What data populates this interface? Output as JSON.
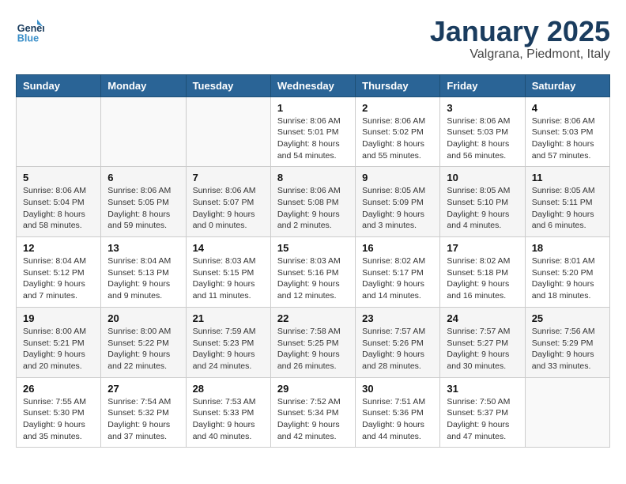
{
  "header": {
    "logo_line1": "General",
    "logo_line2": "Blue",
    "month_title": "January 2025",
    "location": "Valgrana, Piedmont, Italy"
  },
  "weekdays": [
    "Sunday",
    "Monday",
    "Tuesday",
    "Wednesday",
    "Thursday",
    "Friday",
    "Saturday"
  ],
  "weeks": [
    [
      {
        "day": "",
        "info": ""
      },
      {
        "day": "",
        "info": ""
      },
      {
        "day": "",
        "info": ""
      },
      {
        "day": "1",
        "info": "Sunrise: 8:06 AM\nSunset: 5:01 PM\nDaylight: 8 hours\nand 54 minutes."
      },
      {
        "day": "2",
        "info": "Sunrise: 8:06 AM\nSunset: 5:02 PM\nDaylight: 8 hours\nand 55 minutes."
      },
      {
        "day": "3",
        "info": "Sunrise: 8:06 AM\nSunset: 5:03 PM\nDaylight: 8 hours\nand 56 minutes."
      },
      {
        "day": "4",
        "info": "Sunrise: 8:06 AM\nSunset: 5:03 PM\nDaylight: 8 hours\nand 57 minutes."
      }
    ],
    [
      {
        "day": "5",
        "info": "Sunrise: 8:06 AM\nSunset: 5:04 PM\nDaylight: 8 hours\nand 58 minutes."
      },
      {
        "day": "6",
        "info": "Sunrise: 8:06 AM\nSunset: 5:05 PM\nDaylight: 8 hours\nand 59 minutes."
      },
      {
        "day": "7",
        "info": "Sunrise: 8:06 AM\nSunset: 5:07 PM\nDaylight: 9 hours\nand 0 minutes."
      },
      {
        "day": "8",
        "info": "Sunrise: 8:06 AM\nSunset: 5:08 PM\nDaylight: 9 hours\nand 2 minutes."
      },
      {
        "day": "9",
        "info": "Sunrise: 8:05 AM\nSunset: 5:09 PM\nDaylight: 9 hours\nand 3 minutes."
      },
      {
        "day": "10",
        "info": "Sunrise: 8:05 AM\nSunset: 5:10 PM\nDaylight: 9 hours\nand 4 minutes."
      },
      {
        "day": "11",
        "info": "Sunrise: 8:05 AM\nSunset: 5:11 PM\nDaylight: 9 hours\nand 6 minutes."
      }
    ],
    [
      {
        "day": "12",
        "info": "Sunrise: 8:04 AM\nSunset: 5:12 PM\nDaylight: 9 hours\nand 7 minutes."
      },
      {
        "day": "13",
        "info": "Sunrise: 8:04 AM\nSunset: 5:13 PM\nDaylight: 9 hours\nand 9 minutes."
      },
      {
        "day": "14",
        "info": "Sunrise: 8:03 AM\nSunset: 5:15 PM\nDaylight: 9 hours\nand 11 minutes."
      },
      {
        "day": "15",
        "info": "Sunrise: 8:03 AM\nSunset: 5:16 PM\nDaylight: 9 hours\nand 12 minutes."
      },
      {
        "day": "16",
        "info": "Sunrise: 8:02 AM\nSunset: 5:17 PM\nDaylight: 9 hours\nand 14 minutes."
      },
      {
        "day": "17",
        "info": "Sunrise: 8:02 AM\nSunset: 5:18 PM\nDaylight: 9 hours\nand 16 minutes."
      },
      {
        "day": "18",
        "info": "Sunrise: 8:01 AM\nSunset: 5:20 PM\nDaylight: 9 hours\nand 18 minutes."
      }
    ],
    [
      {
        "day": "19",
        "info": "Sunrise: 8:00 AM\nSunset: 5:21 PM\nDaylight: 9 hours\nand 20 minutes."
      },
      {
        "day": "20",
        "info": "Sunrise: 8:00 AM\nSunset: 5:22 PM\nDaylight: 9 hours\nand 22 minutes."
      },
      {
        "day": "21",
        "info": "Sunrise: 7:59 AM\nSunset: 5:23 PM\nDaylight: 9 hours\nand 24 minutes."
      },
      {
        "day": "22",
        "info": "Sunrise: 7:58 AM\nSunset: 5:25 PM\nDaylight: 9 hours\nand 26 minutes."
      },
      {
        "day": "23",
        "info": "Sunrise: 7:57 AM\nSunset: 5:26 PM\nDaylight: 9 hours\nand 28 minutes."
      },
      {
        "day": "24",
        "info": "Sunrise: 7:57 AM\nSunset: 5:27 PM\nDaylight: 9 hours\nand 30 minutes."
      },
      {
        "day": "25",
        "info": "Sunrise: 7:56 AM\nSunset: 5:29 PM\nDaylight: 9 hours\nand 33 minutes."
      }
    ],
    [
      {
        "day": "26",
        "info": "Sunrise: 7:55 AM\nSunset: 5:30 PM\nDaylight: 9 hours\nand 35 minutes."
      },
      {
        "day": "27",
        "info": "Sunrise: 7:54 AM\nSunset: 5:32 PM\nDaylight: 9 hours\nand 37 minutes."
      },
      {
        "day": "28",
        "info": "Sunrise: 7:53 AM\nSunset: 5:33 PM\nDaylight: 9 hours\nand 40 minutes."
      },
      {
        "day": "29",
        "info": "Sunrise: 7:52 AM\nSunset: 5:34 PM\nDaylight: 9 hours\nand 42 minutes."
      },
      {
        "day": "30",
        "info": "Sunrise: 7:51 AM\nSunset: 5:36 PM\nDaylight: 9 hours\nand 44 minutes."
      },
      {
        "day": "31",
        "info": "Sunrise: 7:50 AM\nSunset: 5:37 PM\nDaylight: 9 hours\nand 47 minutes."
      },
      {
        "day": "",
        "info": ""
      }
    ]
  ]
}
